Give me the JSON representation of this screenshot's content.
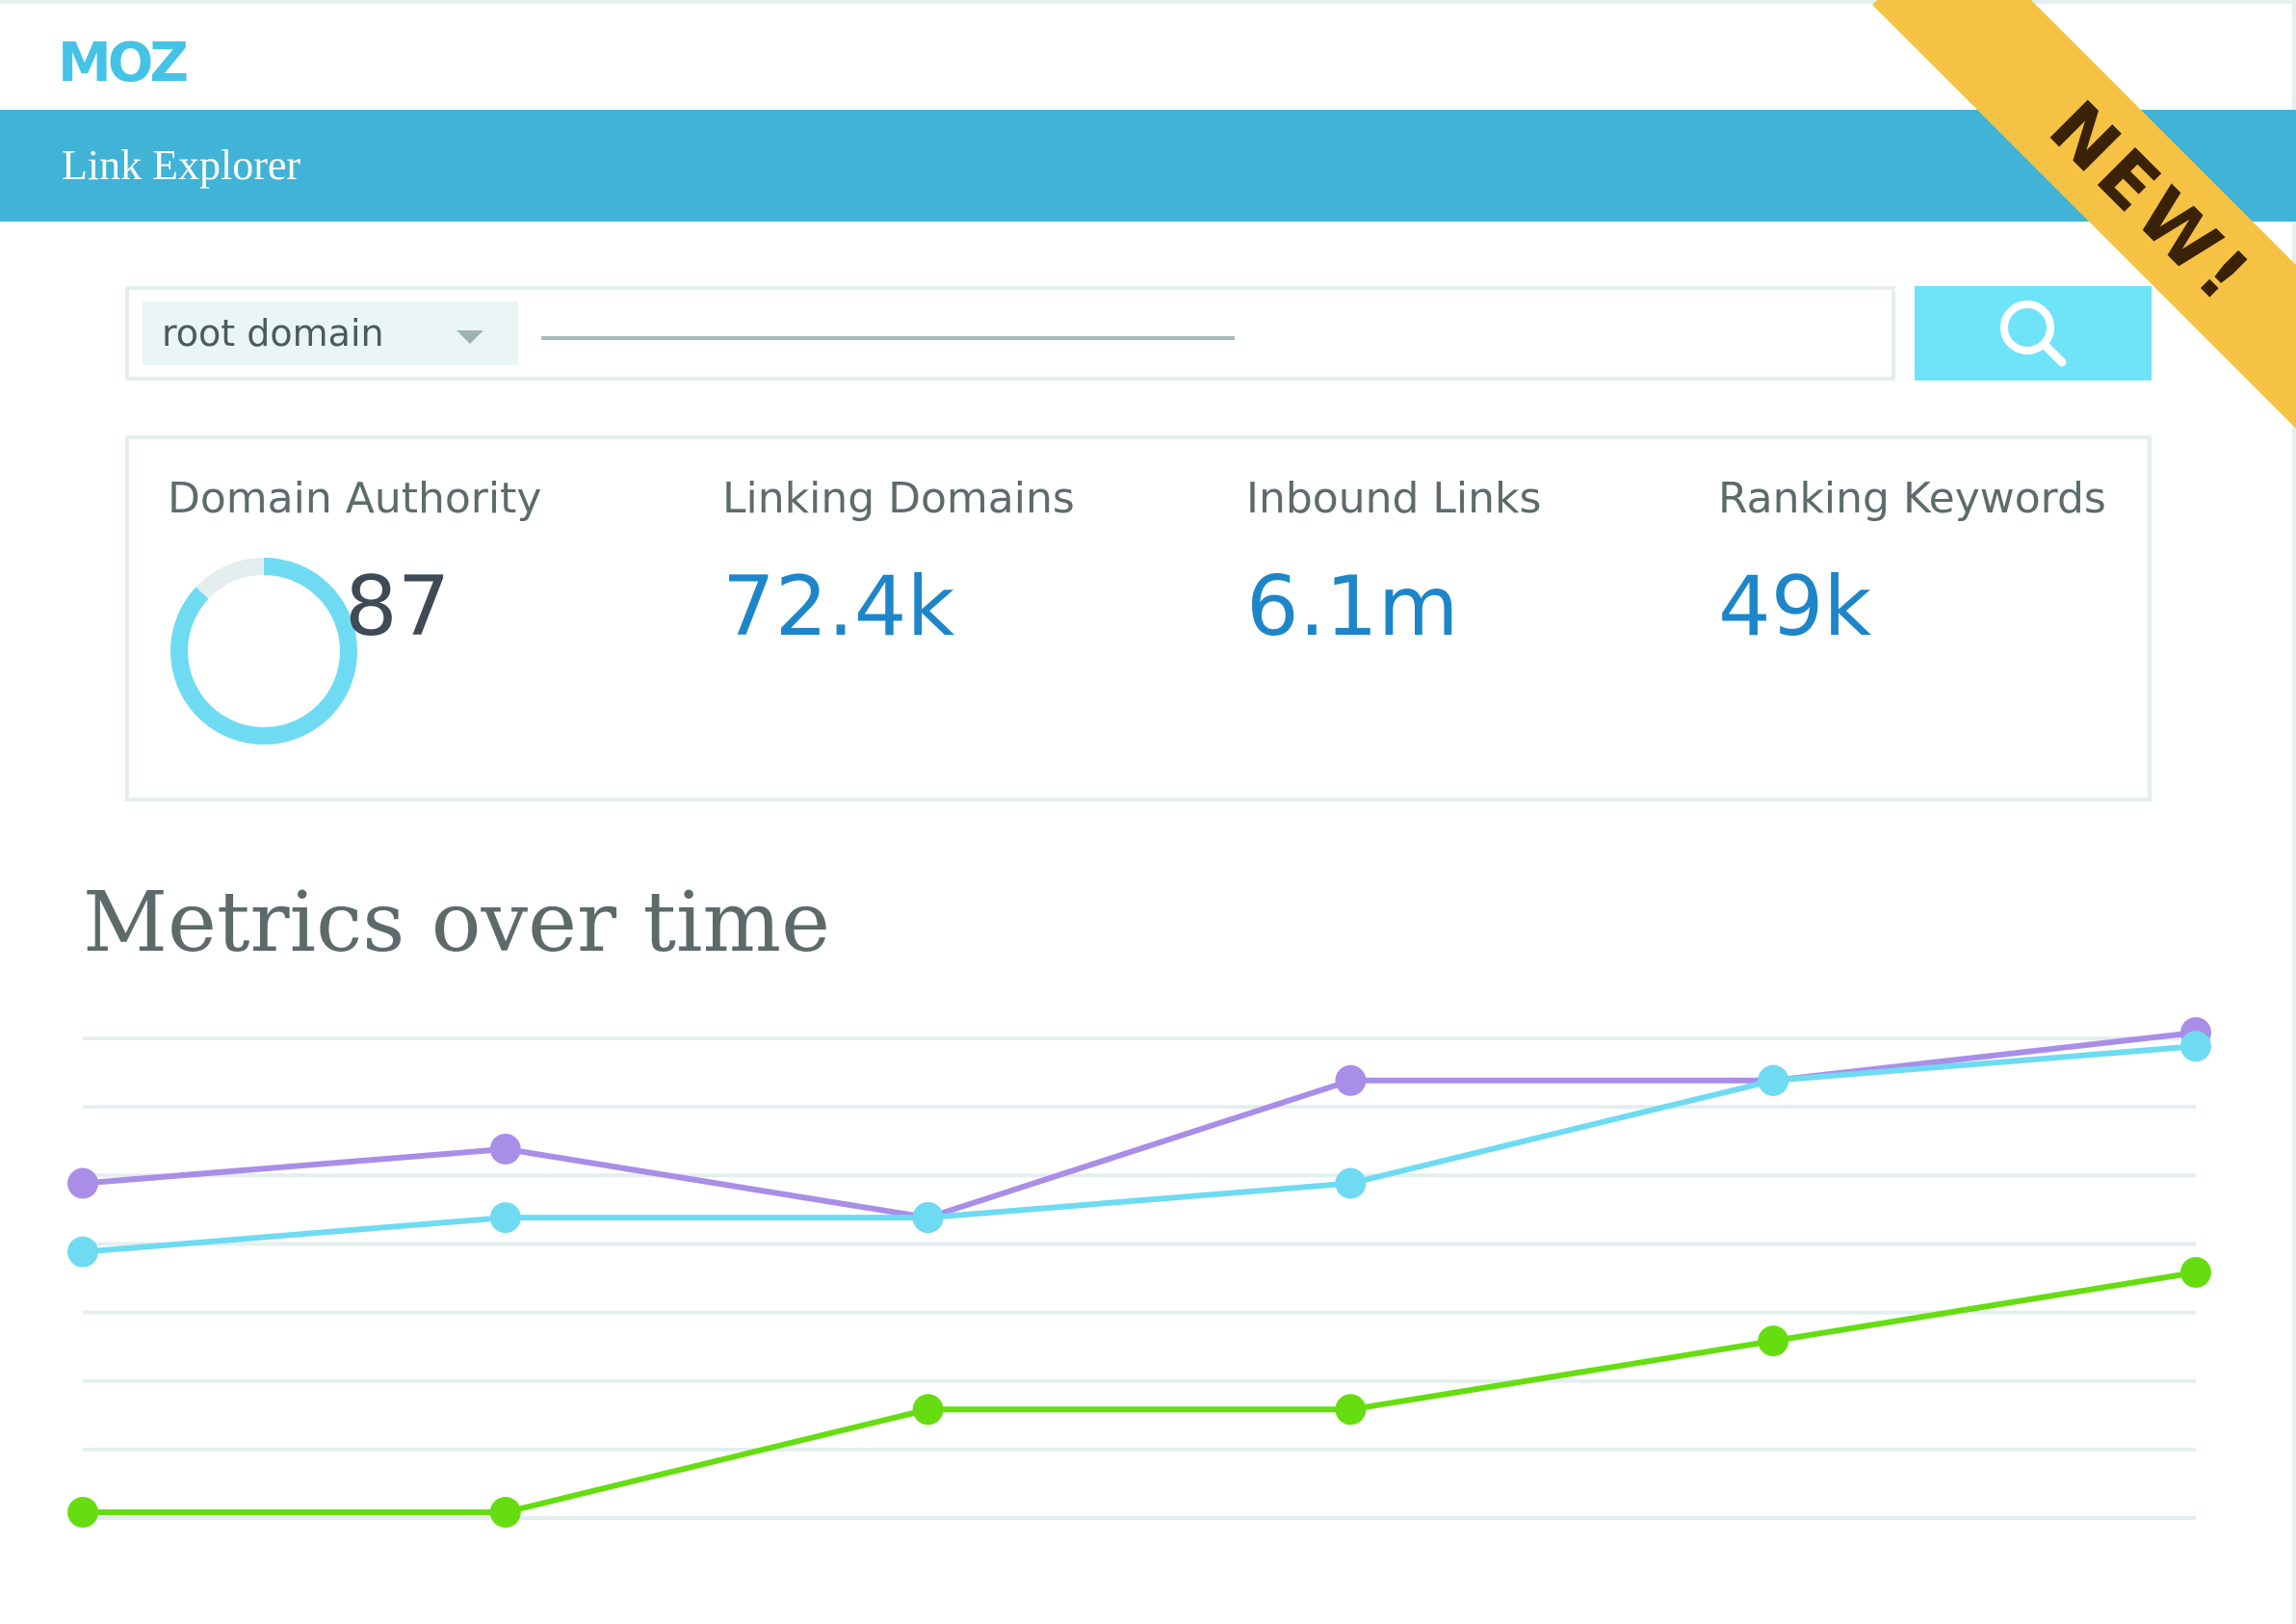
{
  "app": {
    "logo": "MOZ",
    "page_title": "Link Explorer",
    "badge": "NEW!"
  },
  "search": {
    "scope": "root domain",
    "value": ""
  },
  "metrics": {
    "domain_authority": {
      "label": "Domain Authority",
      "value": "87",
      "ring_fraction": 0.87
    },
    "linking_domains": {
      "label": "Linking Domains",
      "value": "72.4k"
    },
    "inbound_links": {
      "label": "Inbound Links",
      "value": "6.1m"
    },
    "ranking_keywords": {
      "label": "Ranking Keywords",
      "value": "49k"
    }
  },
  "colors": {
    "accent": "#40b3d6",
    "metric_value": "#1e86c8",
    "badge": "#f6c244"
  },
  "chart_data": {
    "type": "line",
    "title": "Metrics over time",
    "x": [
      1,
      2,
      3,
      4,
      5,
      6
    ],
    "ylim": [
      0,
      7
    ],
    "grid": true,
    "series": [
      {
        "color": "#a98ee8",
        "values": [
          4.8,
          5.3,
          4.3,
          6.3,
          6.3,
          7.0
        ]
      },
      {
        "color": "#6fdbf2",
        "values": [
          3.8,
          4.3,
          4.3,
          4.8,
          6.3,
          6.8
        ]
      },
      {
        "color": "#66dd11",
        "values": [
          0.0,
          0.0,
          1.5,
          1.5,
          2.5,
          3.5
        ]
      }
    ]
  }
}
